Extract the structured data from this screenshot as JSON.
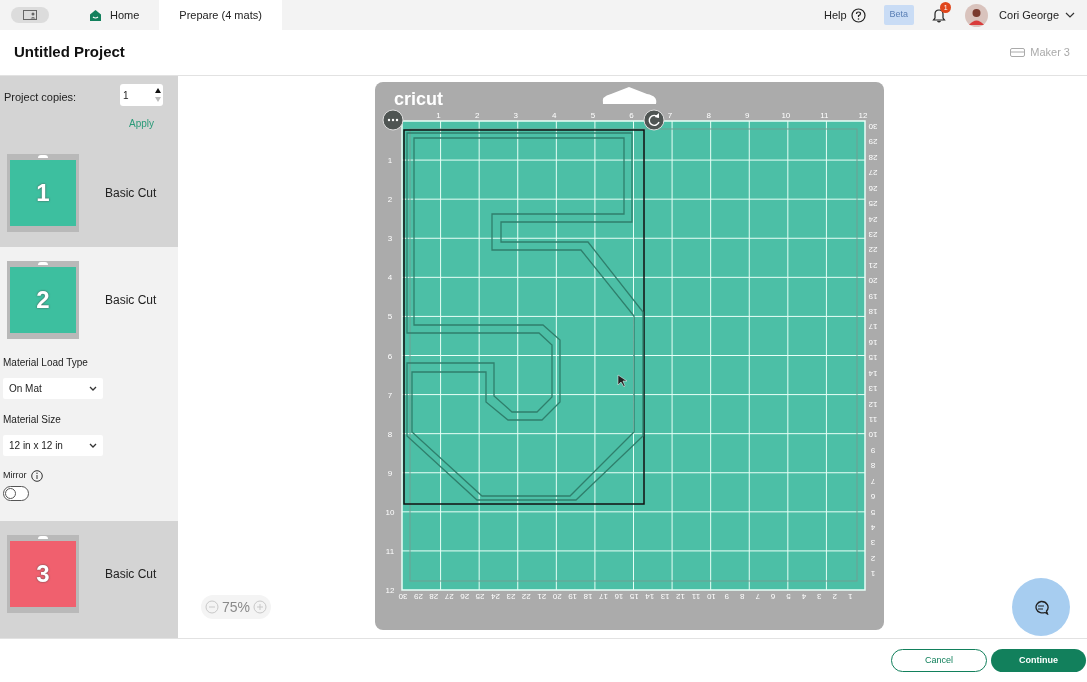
{
  "top_bar": {
    "tabs": [
      {
        "label": "Home",
        "selected": false
      },
      {
        "label": "Prepare (4 mats)",
        "selected": true
      }
    ],
    "help": "Help",
    "beta": "Beta",
    "notification_count": "1",
    "user": "Cori George"
  },
  "project": {
    "title": "Untitled Project",
    "machine": "Maker 3"
  },
  "sidebar": {
    "copies_label": "Project copies:",
    "copies_value": "1",
    "apply": "Apply",
    "mats": [
      {
        "number": "1",
        "label": "Basic Cut",
        "color": "#3dbf9f",
        "selected": false
      },
      {
        "number": "2",
        "label": "Basic Cut",
        "color": "#3dbf9f",
        "selected": true
      },
      {
        "number": "3",
        "label": "Basic Cut",
        "color": "#f0606e",
        "selected": false
      }
    ],
    "settings": {
      "load_type_label": "Material Load Type",
      "load_type": "On Mat",
      "size_label": "Material Size",
      "size": "12 in x 12 in",
      "mirror_label": "Mirror",
      "mirror_on": false
    }
  },
  "mat": {
    "brand": "cricut",
    "top_ruler": [
      "1",
      "2",
      "3",
      "4",
      "5",
      "6",
      "7",
      "8",
      "9",
      "10",
      "11",
      "12"
    ],
    "left_ruler": [
      "1",
      "2",
      "3",
      "4",
      "5",
      "6",
      "7",
      "8",
      "9",
      "10",
      "11",
      "12"
    ],
    "right_ruler": [
      "30",
      "29",
      "28",
      "27",
      "26",
      "25",
      "24",
      "23",
      "22",
      "21",
      "20",
      "19",
      "18",
      "17",
      "16",
      "15",
      "14",
      "13",
      "12",
      "11",
      "10",
      "9",
      "8",
      "7",
      "6",
      "5",
      "4",
      "3",
      "2",
      "1"
    ],
    "bottom_ruler": [
      "30",
      "29",
      "28",
      "27",
      "26",
      "25",
      "24",
      "23",
      "22",
      "21",
      "20",
      "19",
      "18",
      "17",
      "16",
      "15",
      "14",
      "13",
      "12",
      "11",
      "10",
      "9",
      "8",
      "7",
      "6",
      "5",
      "4",
      "3",
      "2",
      "1"
    ]
  },
  "zoom": "75%",
  "buttons": [
    "Cancel",
    "Continue"
  ]
}
